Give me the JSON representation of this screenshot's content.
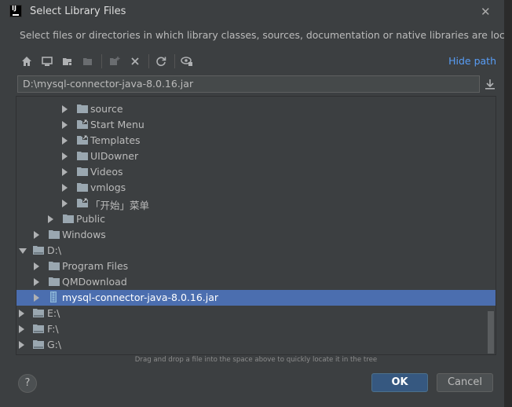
{
  "window": {
    "title": "Select Library Files",
    "description": "Select files or directories in which library classes, sources, documentation or native libraries are located"
  },
  "toolbar": {
    "buttons": [
      "home-icon",
      "desktop-icon",
      "project-folder-icon",
      "module-folder-icon",
      "new-folder-icon",
      "delete-icon",
      "refresh-icon",
      "show-hidden-icon"
    ],
    "hide_path_label": "Hide path"
  },
  "path_field": {
    "value": "D:\\mysql-connector-java-8.0.16.jar"
  },
  "tree": {
    "rows": [
      {
        "label": "source",
        "expanded": false
      },
      {
        "label": "Start Menu",
        "expanded": false
      },
      {
        "label": "Templates",
        "expanded": false
      },
      {
        "label": "UIDowner",
        "expanded": false
      },
      {
        "label": "Videos",
        "expanded": false
      },
      {
        "label": "vmlogs",
        "expanded": false
      },
      {
        "label": "「开始」菜单",
        "expanded": false
      },
      {
        "label": "Public",
        "expanded": false
      },
      {
        "label": "Windows",
        "expanded": false
      },
      {
        "label": "D:\\",
        "expanded": true
      },
      {
        "label": "Program Files",
        "expanded": false
      },
      {
        "label": "QMDownload",
        "expanded": false
      },
      {
        "label": "mysql-connector-java-8.0.16.jar",
        "expanded": false,
        "selected": true
      },
      {
        "label": "E:\\",
        "expanded": false
      },
      {
        "label": "F:\\",
        "expanded": false
      },
      {
        "label": "G:\\",
        "expanded": false
      }
    ]
  },
  "hint": "Drag and drop a file into the space above to quickly locate it in the tree",
  "buttons": {
    "help": "?",
    "ok": "OK",
    "cancel": "Cancel"
  },
  "colors": {
    "accent": "#589df6",
    "selection": "#4b6eaf",
    "ok_button": "#365880"
  }
}
